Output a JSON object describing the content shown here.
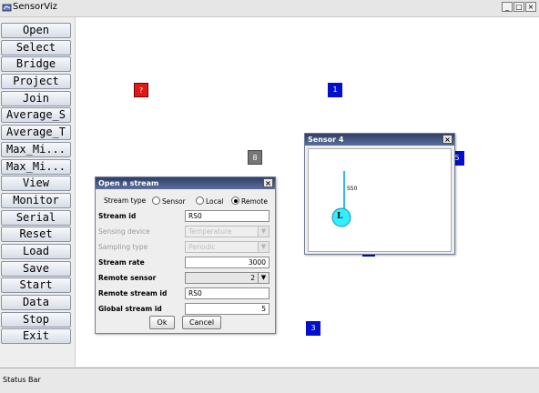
{
  "window": {
    "title": "SensorViz",
    "controls": {
      "minimize": "_",
      "maximize": "□",
      "close": "×"
    }
  },
  "sidebar": {
    "buttons": [
      "Open",
      "Select",
      "Bridge",
      "Project",
      "Join",
      "Average_S",
      "Average_T",
      "Max_Mi...",
      "Max_Mi...",
      "View",
      "Monitor",
      "Serial",
      "Reset",
      "Load",
      "Save",
      "Start",
      "Data",
      "Stop",
      "Exit"
    ]
  },
  "canvas": {
    "nodes": {
      "red": "?",
      "n1": "1",
      "n8": "8",
      "n3": "3",
      "partial": "5"
    }
  },
  "sensor_window": {
    "title": "Sensor 4",
    "close": "×",
    "stream_label": "S50",
    "sensor_letter": "L"
  },
  "dialog": {
    "title": "Open a stream",
    "close": "×",
    "stream_type": {
      "label": "Stream type",
      "options": [
        "Sensor",
        "Local",
        "Remote"
      ],
      "selected": "Remote"
    },
    "fields": {
      "stream_id": {
        "label": "Stream id",
        "value": "RS0"
      },
      "sensing_device": {
        "label": "Sensing device",
        "value": "Temperature"
      },
      "sampling_type": {
        "label": "Sampling type",
        "value": "Periodic"
      },
      "stream_rate": {
        "label": "Stream rate",
        "value": "3000"
      },
      "remote_sensor": {
        "label": "Remote sensor",
        "value": "2"
      },
      "remote_stream_id": {
        "label": "Remote stream id",
        "value": "RS0"
      },
      "global_stream_id": {
        "label": "Global stream id",
        "value": "5"
      }
    },
    "ok": "Ok",
    "cancel": "Cancel"
  },
  "status_bar": {
    "text": "Status Bar"
  },
  "colors": {
    "node_blue": "#0010cc",
    "node_red": "#e01818",
    "node_grey": "#777777",
    "dialog_title": "#3b4b77",
    "sensor_line": "#33bbdd",
    "sensor_circle": "#33eeff"
  }
}
